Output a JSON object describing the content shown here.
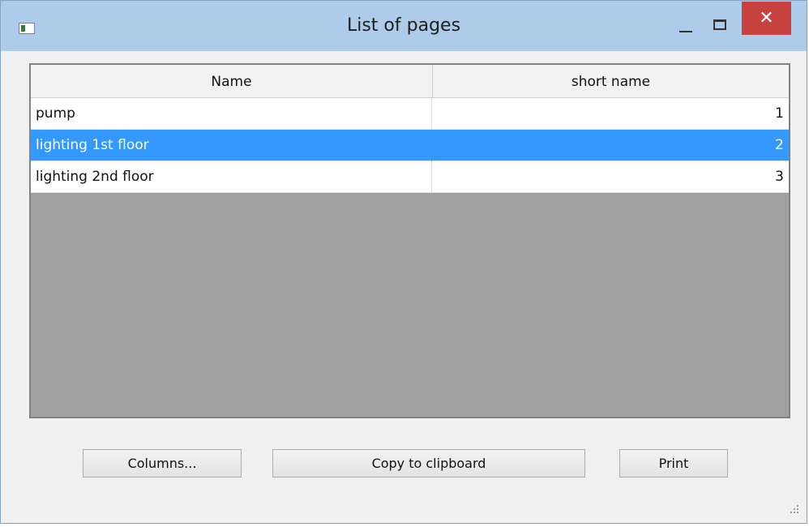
{
  "window": {
    "title": "List of pages",
    "close_glyph": "✕"
  },
  "table": {
    "columns": [
      "Name",
      "short name"
    ],
    "rows": [
      {
        "name": "pump",
        "short": "1",
        "selected": false
      },
      {
        "name": "lighting 1st floor",
        "short": "2",
        "selected": true
      },
      {
        "name": "lighting 2nd floor",
        "short": "3",
        "selected": false
      }
    ]
  },
  "buttons": {
    "columns": "Columns...",
    "copy": "Copy to clipboard",
    "print": "Print"
  },
  "colors": {
    "titlebar": "#aecbea",
    "close": "#c7423e",
    "selection": "#3399ff",
    "empty_area": "#a0a0a0"
  }
}
